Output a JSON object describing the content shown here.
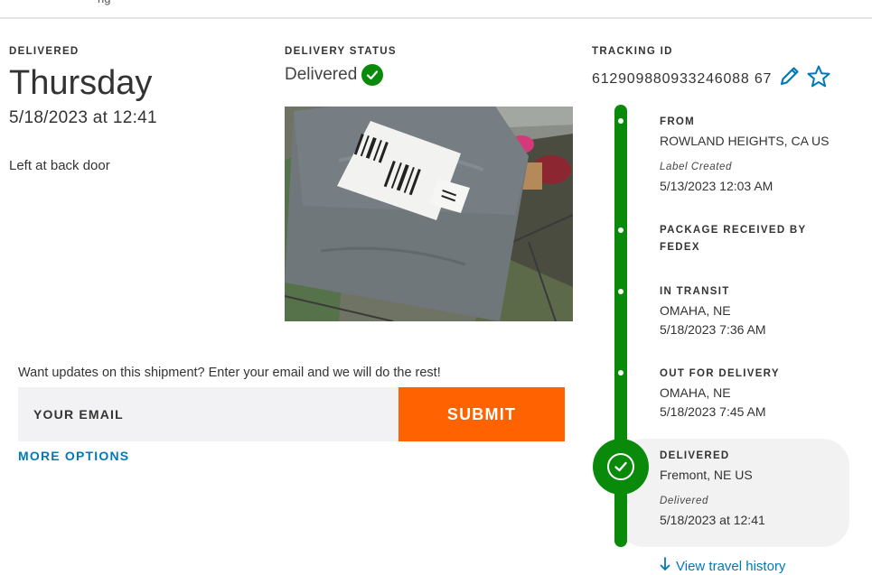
{
  "header": {
    "cropped_text": "ng"
  },
  "delivered_section": {
    "label": "DELIVERED",
    "day": "Thursday",
    "datetime": "5/18/2023 at 12:41",
    "note": "Left at back door"
  },
  "status_section": {
    "label": "DELIVERY STATUS",
    "status": "Delivered"
  },
  "tracking_section": {
    "label": "TRACKING ID",
    "tracking_id": "612909880933246088 67"
  },
  "email": {
    "prompt": "Want updates on this shipment? Enter your email and we will do the rest!",
    "placeholder": "YOUR EMAIL",
    "submit_label": "SUBMIT",
    "more_options": "MORE OPTIONS"
  },
  "timeline": {
    "from": {
      "title": "FROM",
      "location": "ROWLAND HEIGHTS, CA US",
      "sub_label": "Label Created",
      "datetime": "5/13/2023 12:03 AM"
    },
    "received": {
      "title_line1": "PACKAGE RECEIVED BY",
      "title_line2": "FEDEX"
    },
    "in_transit": {
      "title": "IN TRANSIT",
      "location": "OMAHA, NE",
      "datetime": "5/18/2023 7:36 AM"
    },
    "out_for_delivery": {
      "title": "OUT FOR DELIVERY",
      "location": "OMAHA, NE",
      "datetime": "5/18/2023 7:45 AM"
    },
    "delivered": {
      "title": "DELIVERED",
      "location": "Fremont, NE US",
      "sub_label": "Delivered",
      "datetime": "5/18/2023 at 12:41"
    },
    "travel_history": "View travel history"
  },
  "colors": {
    "accent_green": "#0a8a0a",
    "submit_orange": "#ff6200",
    "link_blue": "#007ab7"
  },
  "icons": [
    "check-icon",
    "pencil-icon",
    "star-icon",
    "arrow-down-icon"
  ]
}
